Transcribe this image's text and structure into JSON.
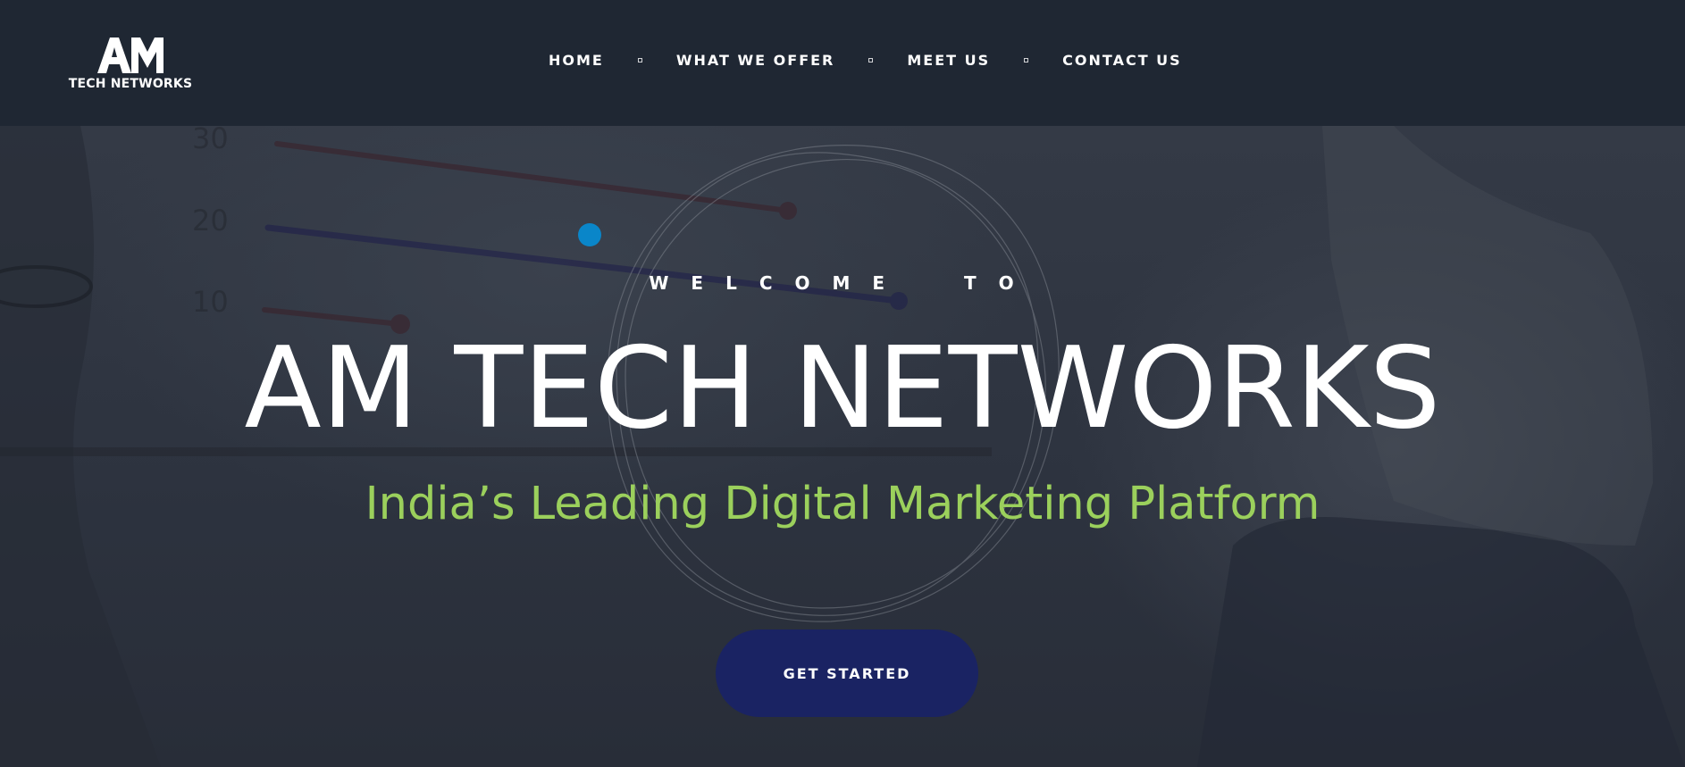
{
  "brand": {
    "logo_mark": "AM",
    "logo_text": "TECH NETWORKS"
  },
  "nav": {
    "items": [
      {
        "label": "HOME"
      },
      {
        "label": "WHAT WE OFFER"
      },
      {
        "label": "MEET US"
      },
      {
        "label": "CONTACT US"
      }
    ]
  },
  "hero": {
    "welcome": "WELCOME  TO",
    "title": "AM TECH NETWORKS",
    "subtitle": "India’s Leading Digital Marketing Platform",
    "cta_label": "GET STARTED",
    "background_labels": [
      "30",
      "20",
      "10"
    ]
  },
  "colors": {
    "header_bg": "#1f2733",
    "subtitle": "#9bd05c",
    "cta_bg": "#1a2363",
    "accent_dot": "#0a86c9"
  }
}
